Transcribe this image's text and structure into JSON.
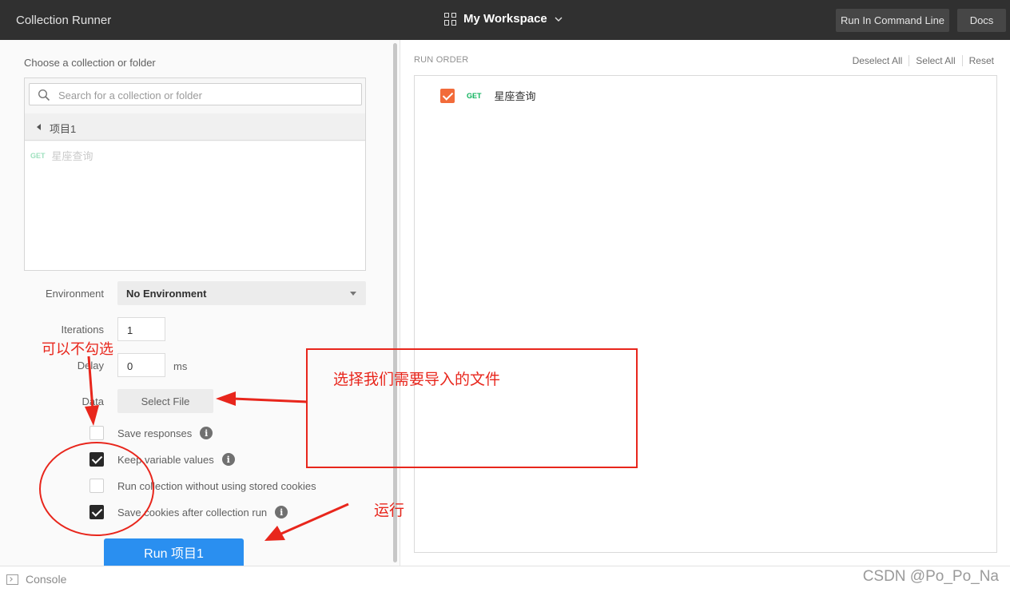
{
  "topbar": {
    "title": "Collection Runner",
    "workspace": "My Workspace",
    "cli_button": "Run In Command Line",
    "docs_button": "Docs"
  },
  "left": {
    "choose_label": "Choose a collection or folder",
    "search_placeholder": "Search for a collection or folder",
    "collection_name": "项目1",
    "requests": [
      {
        "method": "GET",
        "name": "星座查询"
      }
    ],
    "environment_label": "Environment",
    "environment_value": "No Environment",
    "iterations_label": "Iterations",
    "iterations_value": "1",
    "delay_label": "Delay",
    "delay_value": "0",
    "delay_unit": "ms",
    "data_label": "Data",
    "select_file": "Select File",
    "options": [
      {
        "label": "Save responses",
        "checked": false,
        "info": true
      },
      {
        "label": "Keep variable values",
        "checked": true,
        "info": true
      },
      {
        "label": "Run collection without using stored cookies",
        "checked": false,
        "info": false
      },
      {
        "label": "Save cookies after collection run",
        "checked": true,
        "info": true
      }
    ],
    "run_button": "Run 项目1"
  },
  "right": {
    "run_order_label": "RUN ORDER",
    "deselect_all": "Deselect All",
    "select_all": "Select All",
    "reset": "Reset",
    "items": [
      {
        "method": "GET",
        "name": "星座查询",
        "checked": true
      }
    ]
  },
  "statusbar": {
    "console": "Console",
    "watermark": "CSDN @Po_Po_Na"
  },
  "annotations": {
    "optional": "可以不勾选",
    "select_file_note": "选择我们需要导入的文件",
    "run_note": "运行",
    "color": "#e8261c"
  },
  "colors": {
    "accent_blue": "#2a8ff0",
    "checkbox_orange": "#f26b3a",
    "method_green": "#0cb25b",
    "topbar": "#303030"
  }
}
